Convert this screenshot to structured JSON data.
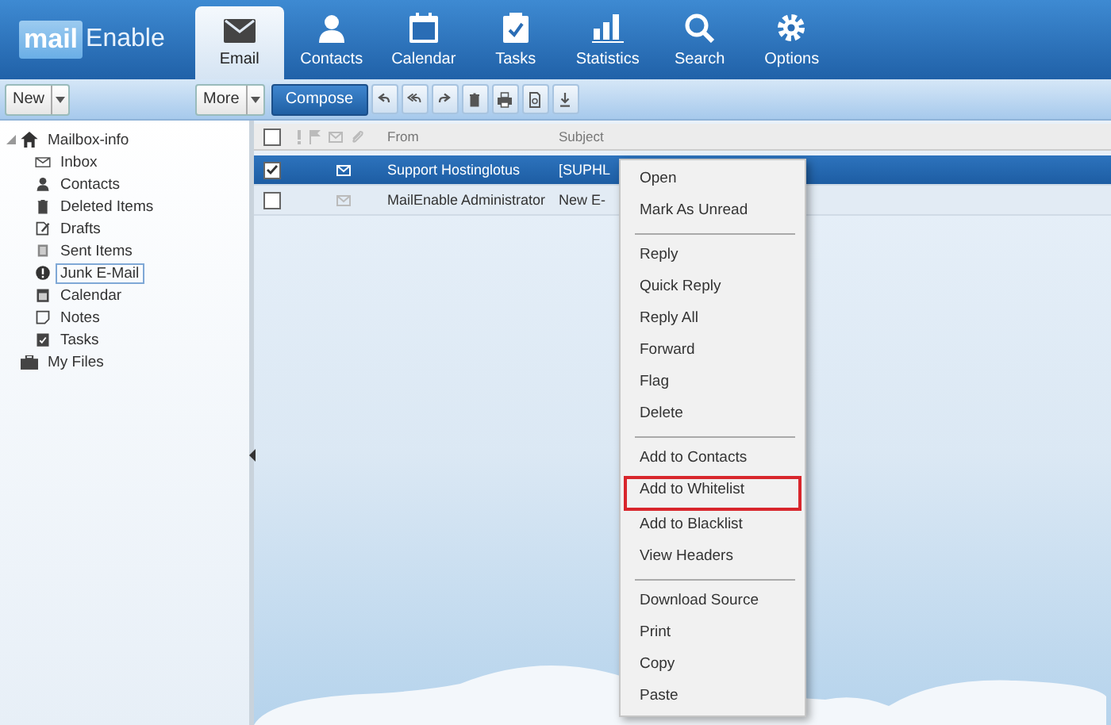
{
  "logo": {
    "part_1": "mail",
    "part_2": "Enable"
  },
  "nav_tabs": [
    {
      "label": "Email",
      "selected": true
    },
    {
      "label": "Contacts",
      "selected": false
    },
    {
      "label": "Calendar",
      "selected": false
    },
    {
      "label": "Tasks",
      "selected": false
    },
    {
      "label": "Statistics",
      "selected": false
    },
    {
      "label": "Search",
      "selected": false
    },
    {
      "label": "Options",
      "selected": false
    }
  ],
  "toolbar": {
    "new_button": "New",
    "more_button": "More",
    "compose_button": "Compose"
  },
  "folder_tree": [
    {
      "label": "Mailbox-info",
      "expanded": true,
      "selected": false,
      "children": [
        {
          "label": "Inbox",
          "selected": false
        },
        {
          "label": "Contacts",
          "selected": false
        },
        {
          "label": "Deleted Items",
          "selected": false
        },
        {
          "label": "Drafts",
          "selected": false
        },
        {
          "label": "Sent Items",
          "selected": false
        },
        {
          "label": "Junk E-Mail",
          "selected": true
        },
        {
          "label": "Calendar",
          "selected": false
        },
        {
          "label": "Notes",
          "selected": false
        },
        {
          "label": "Tasks",
          "selected": false
        }
      ]
    },
    {
      "label": "My Files",
      "expanded": false,
      "selected": false
    }
  ],
  "message_list": {
    "columns": {
      "from": "From",
      "subject": "Subject"
    },
    "all_checked": false,
    "rows": [
      {
        "from": "Support Hostinglotus",
        "subject": "[SUPHL",
        "selected": true,
        "checked": true
      },
      {
        "from": "MailEnable Administrator",
        "subject": "New E-",
        "selected": false,
        "checked": false
      }
    ]
  },
  "context_menu": {
    "sections": [
      {
        "items": [
          {
            "label": "Open",
            "highlighted": false
          },
          {
            "label": "Mark As Unread",
            "highlighted": false
          }
        ]
      },
      {
        "items": [
          {
            "label": "Reply",
            "highlighted": false
          },
          {
            "label": "Quick Reply",
            "highlighted": false
          },
          {
            "label": "Reply All",
            "highlighted": false
          },
          {
            "label": "Forward",
            "highlighted": false
          },
          {
            "label": "Flag",
            "highlighted": false
          },
          {
            "label": "Delete",
            "highlighted": false
          }
        ]
      },
      {
        "items": [
          {
            "label": "Add to Contacts",
            "highlighted": false
          },
          {
            "label": "Add to Whitelist",
            "highlighted": true
          },
          {
            "label": "Add to Blacklist",
            "highlighted": false
          },
          {
            "label": "View Headers",
            "highlighted": false
          }
        ]
      },
      {
        "items": [
          {
            "label": "Download Source",
            "highlighted": false
          },
          {
            "label": "Print",
            "highlighted": false
          },
          {
            "label": "Copy",
            "highlighted": false
          },
          {
            "label": "Paste",
            "highlighted": false
          }
        ]
      }
    ]
  }
}
